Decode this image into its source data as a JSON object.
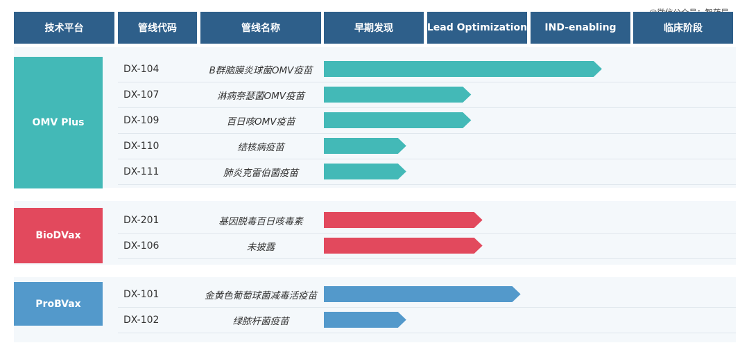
{
  "watermark": "@微信公众号：智药局",
  "header": {
    "platform": "技术平台",
    "code": "管线代码",
    "name": "管线名称",
    "stages": [
      "早期发现",
      "Lead Optimization",
      "IND-enabling",
      "临床阶段"
    ]
  },
  "chart_data": {
    "type": "bar",
    "orientation": "horizontal",
    "stages": [
      "早期发现",
      "Lead Optimization",
      "IND-enabling",
      "临床阶段"
    ],
    "progress_unit": "stages completed (0-4)",
    "groups": [
      {
        "platform": "OMV Plus",
        "color": "#43b9b7",
        "items": [
          {
            "code": "DX-104",
            "name": "B群脑膜炎球菌OMV疫苗",
            "progress": 2.7
          },
          {
            "code": "DX-107",
            "name": "淋病奈瑟菌OMV疫苗",
            "progress": 1.43
          },
          {
            "code": "DX-109",
            "name": "百日咳OMV疫苗",
            "progress": 1.43
          },
          {
            "code": "DX-110",
            "name": "结核病疫苗",
            "progress": 0.8
          },
          {
            "code": "DX-111",
            "name": "肺炎克雷伯菌疫苗",
            "progress": 0.8
          }
        ]
      },
      {
        "platform": "BioDVax",
        "color": "#e2495d",
        "items": [
          {
            "code": "DX-201",
            "name": "基因脱毒百日咳毒素",
            "progress": 1.54
          },
          {
            "code": "DX-106",
            "name": "未披露",
            "progress": 1.54
          }
        ]
      },
      {
        "platform": "ProBVax",
        "color": "#5399cb",
        "items": [
          {
            "code": "DX-101",
            "name": "金黄色葡萄球菌减毒活疫苗",
            "progress": 1.91
          },
          {
            "code": "DX-102",
            "name": "绿脓杆菌疫苗",
            "progress": 0.8
          }
        ]
      }
    ]
  }
}
